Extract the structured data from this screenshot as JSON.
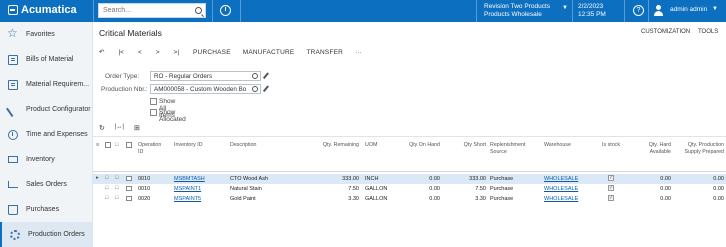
{
  "app": {
    "brand": "Acumatica"
  },
  "topbar": {
    "search_placeholder": "Search...",
    "company": "Revision Two Products",
    "branch": "Products Wholesale",
    "date": "2/2/2023",
    "time": "12:35 PM",
    "user": "admin admin",
    "help_glyph": "?"
  },
  "sidebar": {
    "items": [
      {
        "label": "Favorites",
        "icon": "star-icon"
      },
      {
        "label": "Bills of Material",
        "icon": "bill-icon"
      },
      {
        "label": "Material Requirem...",
        "icon": "requirements-icon"
      },
      {
        "label": "Product Configurator",
        "icon": "wrench-icon"
      },
      {
        "label": "Time and Expenses",
        "icon": "clock-icon"
      },
      {
        "label": "Inventory",
        "icon": "truck-icon"
      },
      {
        "label": "Sales Orders",
        "icon": "cart-icon"
      },
      {
        "label": "Purchases",
        "icon": "bag-icon"
      },
      {
        "label": "Production Orders",
        "icon": "gear-icon"
      }
    ]
  },
  "page": {
    "title": "Critical Materials",
    "customization": "CUSTOMIZATION",
    "tools": "TOOLS"
  },
  "toolbar": {
    "undo": "↶",
    "first": "|<",
    "prev": "<",
    "next": ">",
    "last": ">|",
    "purchase": "PURCHASE",
    "manufacture": "MANUFACTURE",
    "transfer": "TRANSFER",
    "more": "···"
  },
  "form": {
    "order_type_label": "Order Type:",
    "order_type_value": "RO - Regular Orders",
    "production_nbr_label": "Production Nbr.:",
    "production_nbr_value": "AM000058 - Custom Wooden Bo",
    "show_all_items": "Show All Items",
    "show_allocated": "Show Allocated"
  },
  "grid": {
    "refresh": "↻",
    "fit": "|↔|",
    "export": "⊞",
    "columns": {
      "operation_id": "Operation ID",
      "inventory_id": "Inventory ID",
      "description": "Description",
      "qty_remaining": "Qty. Remaining",
      "uom": "UOM",
      "qty_on_hand": "Qty On Hand",
      "qty_short": "Qty Short",
      "replenishment_source": "Replenishment Source",
      "warehouse": "Warehouse",
      "in_stock": "Is stock",
      "qty_hard_available": "Qty. Hard Available",
      "qty_production_supply": "Qty. Production Supply Prepared"
    },
    "rows": [
      {
        "operation": "0010",
        "inventory": "MSBMTASH",
        "description": "CTO Wood Ash",
        "qty_remaining": "333.00",
        "uom": "INCH",
        "qty_on_hand": "0.00",
        "qty_short": "333.00",
        "source": "Purchase",
        "warehouse": "WHOLESALE",
        "in_stock": true,
        "hard_available": "0.00",
        "supply_prepared": "0.00"
      },
      {
        "operation": "0010",
        "inventory": "MSPAINT1",
        "description": "Natural Stain",
        "qty_remaining": "7.50",
        "uom": "GALLON",
        "qty_on_hand": "0.00",
        "qty_short": "7.50",
        "source": "Purchase",
        "warehouse": "WHOLESALE",
        "in_stock": true,
        "hard_available": "0.00",
        "supply_prepared": "0.00"
      },
      {
        "operation": "0020",
        "inventory": "MSPAINT5",
        "description": "Gold Paint",
        "qty_remaining": "3.30",
        "uom": "GALLON",
        "qty_on_hand": "0.00",
        "qty_short": "3.30",
        "source": "Purchase",
        "warehouse": "WHOLESALE",
        "in_stock": true,
        "hard_available": "0.00",
        "supply_prepared": "0.00"
      }
    ]
  },
  "colors": {
    "topbar": "#0d6fc0",
    "sidebar": "#f0f4f7",
    "selected_row": "#dbe8f5",
    "link": "#0d5cab"
  }
}
